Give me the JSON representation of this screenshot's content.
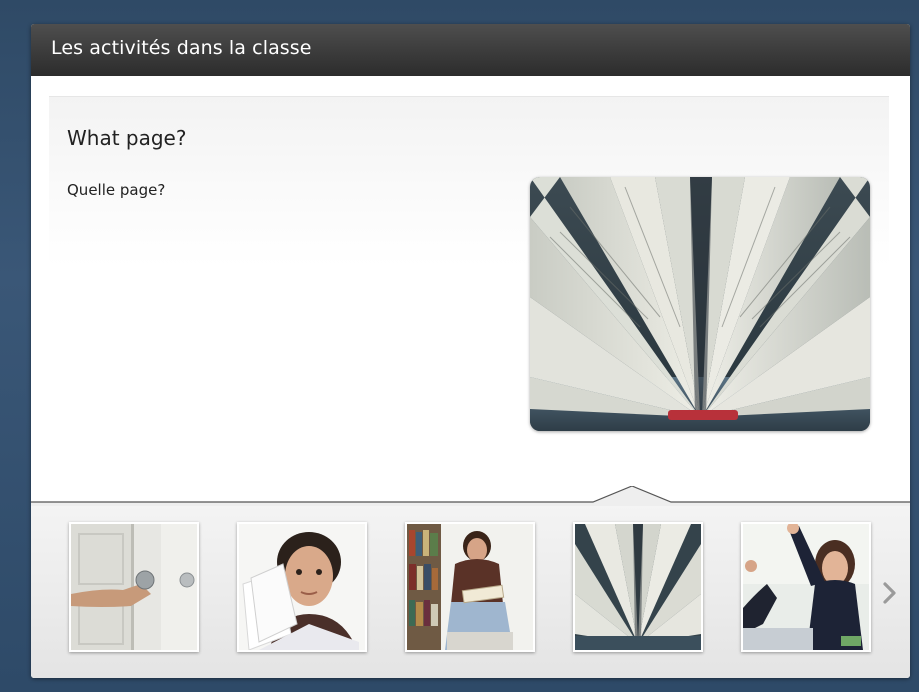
{
  "window": {
    "title": "Les activités dans la classe"
  },
  "content": {
    "heading": "What page?",
    "subheading": "Quelle page?",
    "main_image": "open-book-pages-photo"
  },
  "thumbnails": [
    {
      "image": "hand-opening-door-photo",
      "selected": false
    },
    {
      "image": "student-holding-papers-photo",
      "selected": false
    },
    {
      "image": "student-reading-in-library-photo",
      "selected": false
    },
    {
      "image": "open-book-pages-photo",
      "selected": true
    },
    {
      "image": "student-raising-hand-photo",
      "selected": false
    }
  ],
  "navigation": {
    "next_icon": "chevron-right-icon"
  },
  "colors": {
    "titlebar": "#2c2c2c",
    "background": "#2f4a66",
    "strip": "#e8e8e8"
  }
}
